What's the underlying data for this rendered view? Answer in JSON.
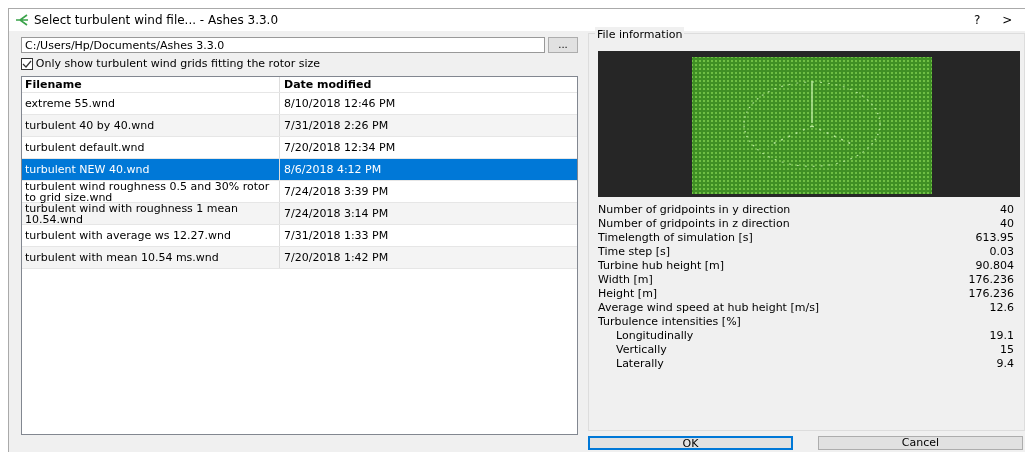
{
  "window": {
    "title": "Select turbulent wind file... - Ashes 3.3.0",
    "controls": [
      "?",
      ">"
    ]
  },
  "path_field": {
    "value": "C:/Users/Hp/Documents/Ashes 3.3.0"
  },
  "browse_button": "...",
  "filter_checkbox": {
    "label": "Only show turbulent wind grids fitting the rotor size",
    "checked": true
  },
  "table": {
    "columns": [
      "Filename",
      "Date modified"
    ],
    "rows": [
      {
        "cells": [
          "extreme 55.wnd",
          "8/10/2018 12:46 PM"
        ],
        "selected": false
      },
      {
        "cells": [
          "turbulent 40 by 40.wnd",
          "7/31/2018 2:26 PM"
        ],
        "selected": false
      },
      {
        "cells": [
          "turbulent default.wnd",
          "7/20/2018 12:34 PM"
        ],
        "selected": false
      },
      {
        "cells": [
          "turbulent NEW 40.wnd",
          "8/6/2018 4:12 PM"
        ],
        "selected": true
      },
      {
        "cells": [
          "turbulent wind roughness 0.5 and 30% rotor to grid size.wnd",
          "7/24/2018 3:39 PM"
        ],
        "selected": false
      },
      {
        "cells": [
          "turbulent wind with roughness 1 mean 10.54.wnd",
          "7/24/2018 3:14 PM"
        ],
        "selected": false
      },
      {
        "cells": [
          "turbulent with average ws 12.27.wnd",
          "7/31/2018 1:33 PM"
        ],
        "selected": false
      },
      {
        "cells": [
          "turbulent with mean 10.54 ms.wnd",
          "7/20/2018 1:42 PM"
        ],
        "selected": false
      }
    ]
  },
  "file_information": {
    "title": "File information",
    "properties": [
      {
        "label": "Number of gridpoints in y direction",
        "value": "40"
      },
      {
        "label": "Number of gridpoints in z direction",
        "value": "40"
      },
      {
        "label": "Timelength of simulation [s]",
        "value": "613.95"
      },
      {
        "label": "Time step [s]",
        "value": "0.03"
      },
      {
        "label": "Turbine hub height [m]",
        "value": "90.804"
      },
      {
        "label": "Width [m]",
        "value": "176.236"
      },
      {
        "label": "Height [m]",
        "value": "176.236"
      },
      {
        "label": "Average wind speed at hub height [m/s]",
        "value": "12.6"
      },
      {
        "label": "Turbulence intensities [%]",
        "children": [
          {
            "label": "Longitudinally",
            "value": "19.1"
          },
          {
            "label": "Vertically",
            "value": "15"
          },
          {
            "label": "Laterally",
            "value": "9.4"
          }
        ]
      }
    ]
  },
  "buttons": [
    {
      "label": "OK",
      "selected": true
    },
    {
      "label": "Cancel",
      "selected": false
    }
  ]
}
